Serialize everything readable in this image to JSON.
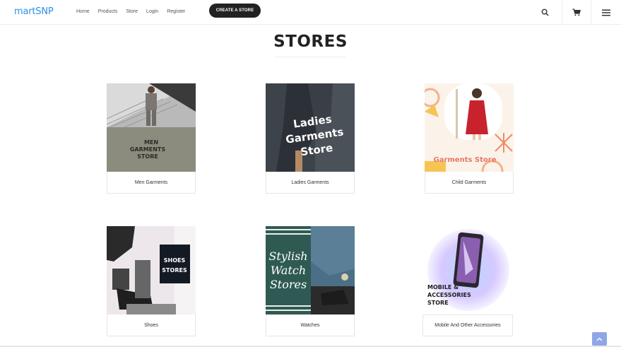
{
  "nav": {
    "brand": "martSNP",
    "links": [
      "Home",
      "Products",
      "Store",
      "Login",
      "Register"
    ],
    "cta_label": "CREATE A STORE",
    "icons": [
      "search-icon",
      "cart-icon",
      "menu-icon"
    ]
  },
  "page": {
    "title": "STORES"
  },
  "stores": [
    {
      "name": "Men Garments",
      "image_text": [
        "MEN",
        "GARMENTS",
        "STORE"
      ]
    },
    {
      "name": "Ladies Garments",
      "image_text": [
        "Ladies",
        "Garments",
        "Store"
      ]
    },
    {
      "name": "Child Garments",
      "image_text": [
        "Garments Store"
      ]
    },
    {
      "name": "Shoes",
      "image_text": [
        "SHOES",
        "STORES"
      ]
    },
    {
      "name": "Watches",
      "image_text": [
        "Stylish",
        "Watch",
        "Stores"
      ]
    },
    {
      "name": "Mobile And Other Accessories",
      "image_text": [
        "MOBILE &",
        "ACCESSORIES",
        "STORE"
      ]
    }
  ],
  "colors": {
    "brand": "#2f8fe8",
    "cta_bg": "#222222",
    "scroll_top_bg": "#8ea6e6"
  }
}
